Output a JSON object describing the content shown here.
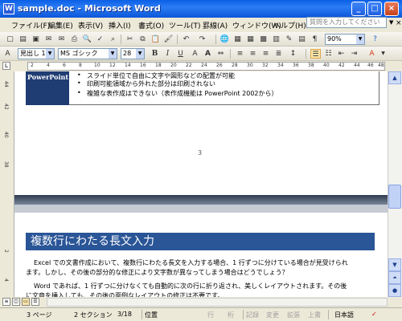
{
  "window": {
    "title": "sample.doc - Microsoft Word",
    "app_icon": "W"
  },
  "menu": {
    "items": [
      "ファイル(F)",
      "編集(E)",
      "表示(V)",
      "挿入(I)",
      "書式(O)",
      "ツール(T)",
      "罫線(A)",
      "ウィンドウ(W)",
      "ヘルプ(H)"
    ],
    "help_placeholder": "質問を入力してください",
    "close_glyph": "×"
  },
  "toolbar": {
    "zoom": "90%",
    "style": "見出し 1",
    "font": "MS ゴシック",
    "size": "28",
    "bold": "B",
    "italic": "I",
    "underline": "U",
    "char_a": "A",
    "big_a": "A"
  },
  "ruler": {
    "numbers": [
      "2",
      "4",
      "6",
      "8",
      "10",
      "12",
      "14",
      "16",
      "18",
      "20",
      "22",
      "24",
      "26",
      "28",
      "30",
      "32",
      "34",
      "36",
      "38",
      "40",
      "42",
      "44",
      "46",
      "48"
    ],
    "tab_selector": "L"
  },
  "vruler": {
    "numbers": [
      "44",
      "42",
      "40",
      "38",
      "2",
      "4"
    ]
  },
  "document": {
    "prev_page": {
      "pp_label": "PowerPoint",
      "bullets": [
        "スライド単位で自由に文字や図形などの配置が可能",
        "印刷可能領域から外れた部分は印刷されない",
        "複雑な表作成はできない（表作成機能は PowerPoint 2002から）"
      ],
      "page_number": "3"
    },
    "heading": "複数行にわたる長文入力",
    "paragraphs": [
      "Excel での文書作成において、複数行にわたる長文を入力する場合、1 行ずつに分けている場合が見受けられ",
      "ます。しかし、その後の部分的な修正により文字数が異なってしまう場合はどうでしょう？",
      "Word であれば、1 行ずつに分けなくても自動的に次の行に折り返され、美しくレイアウトされます。その後",
      "に文章を挿入しても、その後の面倒なレイアウトの修正は不要です。"
    ]
  },
  "status": {
    "page": "3 ページ",
    "section": "2 セクション",
    "pos": "3/18",
    "location": "位置",
    "line": "行",
    "col": "桁",
    "rec": "記録",
    "trk": "変更",
    "ext": "拡張",
    "ovr": "上書",
    "lang": "日本語"
  }
}
